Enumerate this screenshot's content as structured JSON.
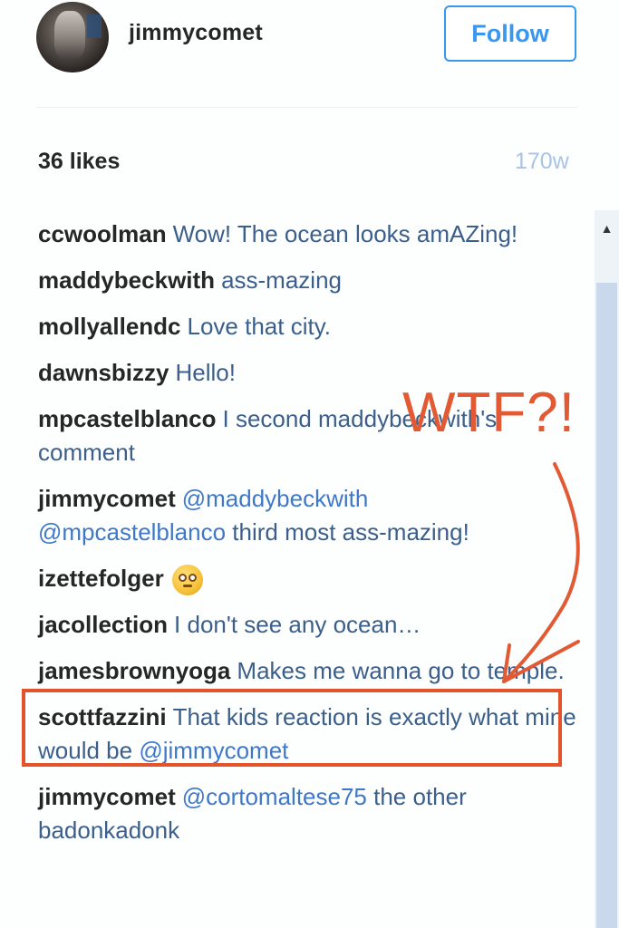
{
  "header": {
    "username": "jimmycomet",
    "follow_label": "Follow"
  },
  "post": {
    "likes": "36 likes",
    "age": "170w"
  },
  "comments": [
    {
      "user": "ccwoolman",
      "text": "Wow! The ocean looks amAZing!"
    },
    {
      "user": "maddybeckwith",
      "text": "ass-mazing"
    },
    {
      "user": "mollyallendc",
      "text": "Love that city."
    },
    {
      "user": "dawnsbizzy",
      "text": "Hello!"
    },
    {
      "user": "mpcastelblanco",
      "text": "I second maddybeckwith's comment"
    },
    {
      "user": "jimmycomet",
      "mention1": "@maddybeckwith",
      "mention2": "@mpcastelblanco",
      "text": "third most ass-mazing!"
    },
    {
      "user": "izettefolger",
      "emoji": "flushed-face-emoji"
    },
    {
      "user": "jacollection",
      "text": "I don't see any ocean…"
    },
    {
      "user": "jamesbrownyoga",
      "text": "Makes me wanna go to temple."
    },
    {
      "user": "scottfazzini",
      "text": "That kids reaction is exactly what mine would be",
      "mention": "@jimmycomet"
    },
    {
      "user": "jimmycomet",
      "mention": "@cortomaltese75",
      "text": "the other badonkadonk"
    }
  ],
  "annotation": {
    "text": "WTF?!",
    "color": "#e25a34"
  },
  "colors": {
    "accent": "#3897f0",
    "mention": "#3f78c8",
    "highlight": "#e5532a"
  }
}
